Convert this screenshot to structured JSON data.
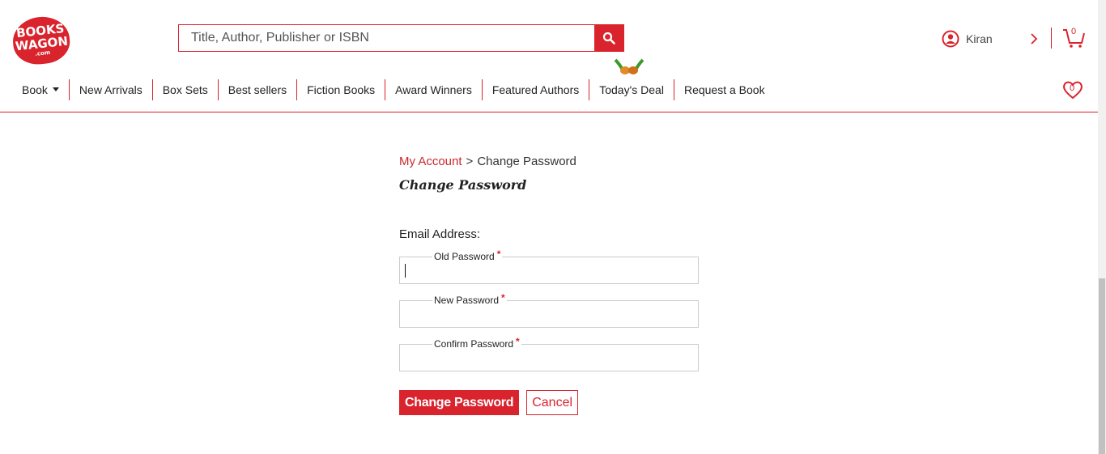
{
  "brand": {
    "logo_line1": "BOOKS",
    "logo_line2": "WAGON",
    "logo_line3": ".com",
    "accent": "#d9232d"
  },
  "search": {
    "placeholder": "Title, Author, Publisher or ISBN",
    "icon": "search-icon"
  },
  "user": {
    "name": "Kiran",
    "icon": "user-circle-icon"
  },
  "cart": {
    "count": "0",
    "icon": "cart-icon"
  },
  "wishlist": {
    "count": "0",
    "icon": "heart-icon"
  },
  "nav": {
    "items": [
      {
        "label": "Book"
      },
      {
        "label": "New Arrivals"
      },
      {
        "label": "Box Sets"
      },
      {
        "label": "Best sellers"
      },
      {
        "label": "Fiction Books"
      },
      {
        "label": "Award Winners"
      },
      {
        "label": "Featured Authors"
      },
      {
        "label": "Today's Deal"
      },
      {
        "label": "Request a Book"
      }
    ]
  },
  "breadcrumb": {
    "parent": "My Account",
    "separator": ">",
    "current": "Change Password"
  },
  "page": {
    "title": "Change Password",
    "email_label": "Email Address:",
    "fields": [
      {
        "label": "Old Password",
        "required": "*",
        "value": ""
      },
      {
        "label": "New Password",
        "required": "*",
        "value": ""
      },
      {
        "label": "Confirm Password",
        "required": "*",
        "value": ""
      }
    ],
    "submit_label": "Change Password",
    "cancel_label": "Cancel"
  }
}
